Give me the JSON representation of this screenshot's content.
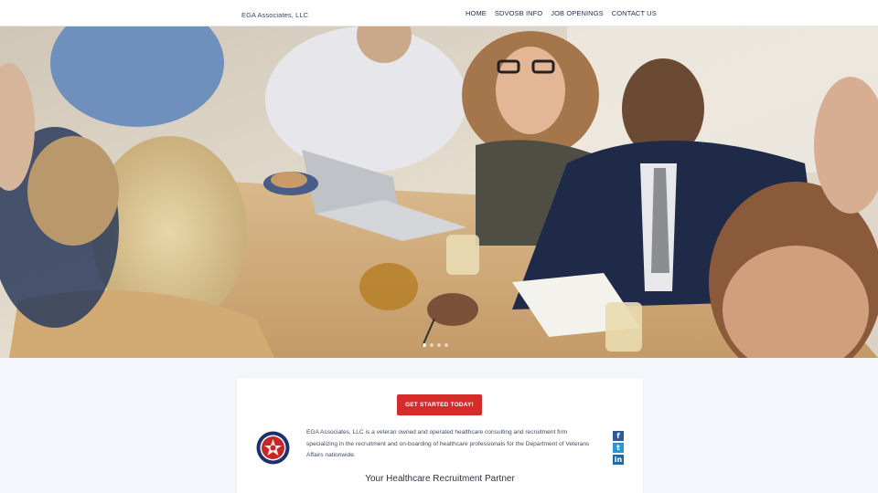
{
  "header": {
    "brand": "EGA Associates, LLC",
    "nav": [
      "HOME",
      "SDVOSB INFO",
      "JOB OPENINGS",
      "CONTACT US"
    ]
  },
  "hero": {
    "image": "office-meeting-photo",
    "slide_count": 4,
    "active_slide": 1
  },
  "card": {
    "cta_label": "GET STARTED TODAY!",
    "description": "EGA Associates, LLC is a veteran owned and operated healthcare consulting and recruitment firm specializing in the recruitment and on-boarding of healthcare professionals for the Department of Veterans Affairs nationwide.",
    "tagline": "Your Healthcare Recruitment Partner",
    "logo": "veteran-seal-logo",
    "social_icons": [
      "facebook-icon",
      "twitter-icon",
      "linkedin-icon"
    ]
  },
  "colors": {
    "cta": "#d42b2b",
    "nav_text": "#1f2d4d",
    "page_bg": "#f4f6fb",
    "facebook": "#2f5b9c",
    "twitter": "#2a96d6",
    "linkedin": "#1a6ba8"
  }
}
